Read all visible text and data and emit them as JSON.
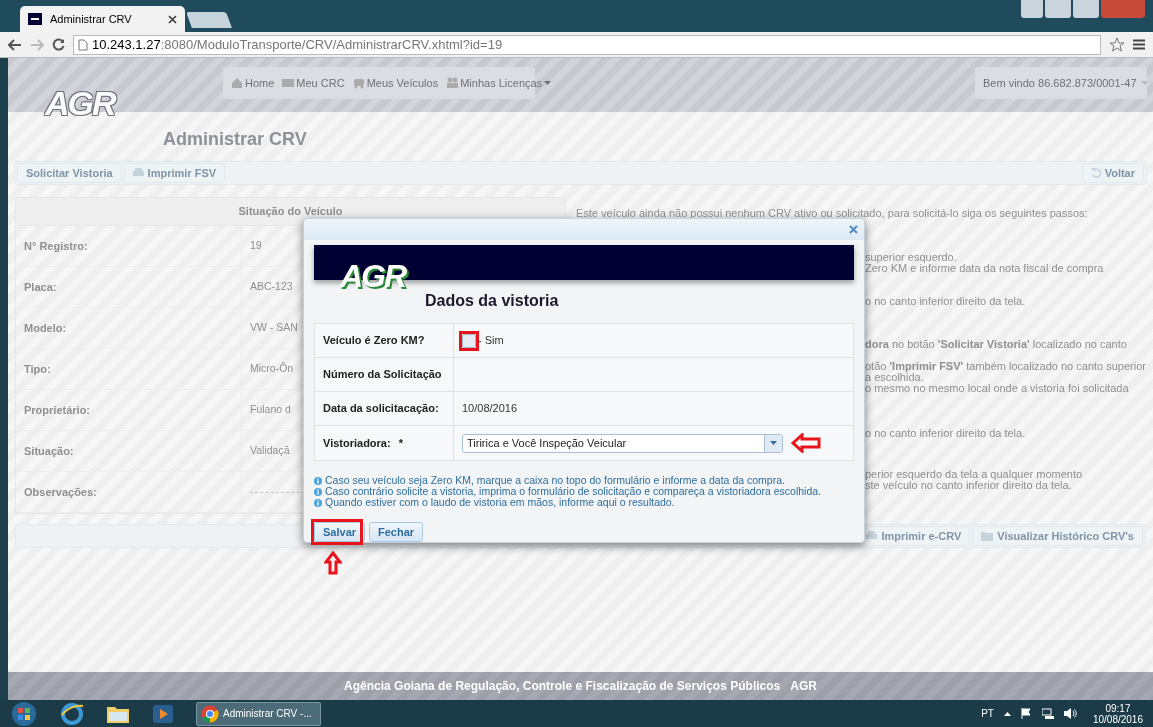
{
  "browser": {
    "tab_title": "Administrar CRV",
    "url_host": "10.243.1.27",
    "url_rest": ":8080/ModuloTransporte/CRV/AdministrarCRV.xhtml?id=19"
  },
  "header": {
    "logo": "AGR",
    "nav": [
      {
        "label": "Home",
        "dropdown": false
      },
      {
        "label": "Meu CRC",
        "dropdown": false
      },
      {
        "label": "Meus Veículos",
        "dropdown": false
      },
      {
        "label": "Minhas Licenças",
        "dropdown": true
      }
    ],
    "welcome": "Bem vindo 86.682.873/0001-47"
  },
  "page_title": "Administrar CRV",
  "toolbar": {
    "left": [
      "Solicitar Vistoria",
      "Imprimir FSV"
    ],
    "right": "Voltar"
  },
  "vehicle_panel": {
    "title": "Situação do Veículo",
    "rows": [
      {
        "label": "N° Registro:",
        "value": "19"
      },
      {
        "label": "Placa:",
        "value": "ABC-123"
      },
      {
        "label": "Modelo:",
        "value": "VW - SAN"
      },
      {
        "label": "Tipo:",
        "value": "Micro-Ôn"
      },
      {
        "label": "Proprietário:",
        "value": "Fulano d"
      },
      {
        "label": "Situação:",
        "value": "Validaçã"
      },
      {
        "label": "Observações:"
      }
    ]
  },
  "instructions": {
    "intro": "Este veículo ainda não possui nenhum CRV ativo ou solicitado, para solicitá-lo siga os seguintes passos:",
    "groups": [
      [
        "superior esquerdo.",
        "Zero KM e informe data da nota fiscal de compra"
      ],
      [
        "o no canto inferior direito da tela."
      ],
      [
        "**dora** no botão **'Solicitar Vistoria'** localizado no canto"
      ],
      [
        "otão **'Imprimir FSV'** também localizado no canto superior",
        "a escolhida.",
        "o mesmo no mesmo local onde a vistoria foi solicitada"
      ],
      [
        "o no canto inferior direito da tela."
      ],
      [
        "perior esquerdo da tela a qualquer momento",
        "ste veículo no canto inferior direito da tela."
      ]
    ]
  },
  "bottom_toolbar": [
    "Imprimir e-CRV",
    "Visualizar Histórico CRV's"
  ],
  "dialog": {
    "logo": "AGR",
    "title": "Dados da vistoria",
    "fields": [
      {
        "kind": "checkbox",
        "label": "Veículo é Zero KM?",
        "checked": false,
        "option": "- Sim"
      },
      {
        "kind": "text",
        "label": "Número da Solicitação"
      },
      {
        "kind": "text",
        "label": "Data da solicitacação:",
        "value": "10/08/2016"
      },
      {
        "kind": "select",
        "label": "Vistoriadora:",
        "required_mark": "*",
        "value": "Tiririca e Você Inspeção Veicular"
      }
    ],
    "notes": [
      "Caso seu veículo seja Zero KM, marque a caixa no topo do formulário e informe a data da compra.",
      "Caso contrário solicite a vistoria, imprima o formulário de solicitação e compareça a vistoriadora escolhida.",
      "Quando estiver com o laudo de vistoria em mãos, informe aqui o resultado."
    ],
    "buttons": [
      "Salvar",
      "Fechar"
    ]
  },
  "footer": {
    "text": "Agência Goiana de Regulação, Controle e Fiscalização de Serviços Públicos",
    "brand": "AGR"
  },
  "taskbar": {
    "window_label": "Administrar CRV -...",
    "language": "PT",
    "time": "09:17",
    "date": "10/08/2016"
  }
}
